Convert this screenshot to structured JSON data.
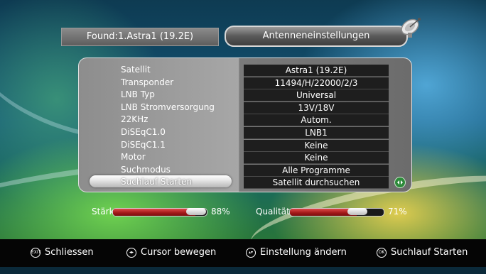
{
  "header": {
    "found_text": "Found:1.Astra1 (19.2E)",
    "title": "Antenneneinstellungen",
    "icon": "satellite-dish-icon"
  },
  "settings": [
    {
      "label": "Satellit",
      "value": "Astra1 (19.2E)"
    },
    {
      "label": "Transponder",
      "value": "11494/H/22000/2/3"
    },
    {
      "label": "LNB Typ",
      "value": "Universal"
    },
    {
      "label": "LNB Stromversorgung",
      "value": "13V/18V"
    },
    {
      "label": "22KHz",
      "value": "Autom."
    },
    {
      "label": "DiSEqC1.0",
      "value": "LNB1"
    },
    {
      "label": "DiSEqC1.1",
      "value": "Keine"
    },
    {
      "label": "Motor",
      "value": "Keine"
    },
    {
      "label": "Suchmodus",
      "value": "Alle Programme"
    },
    {
      "label": "Suchlauf Starten",
      "value": "Satellit durchsuchen",
      "selected": true
    }
  ],
  "signal": {
    "strength_label": "Stärke",
    "strength_value": 0.88,
    "strength_text": "88%",
    "quality_label": "Qualität",
    "quality_value": 0.71,
    "quality_text": "71%"
  },
  "help": [
    {
      "icon": "exit-button-icon",
      "icon_text": "EXIT",
      "label": "Schliessen"
    },
    {
      "icon": "arrow-keys-icon",
      "icon_text": "◂▸",
      "label": "Cursor bewegen"
    },
    {
      "icon": "up-down-keys-icon",
      "icon_text": "▴▾",
      "label": "Einstellung ändern"
    },
    {
      "icon": "ok-button-icon",
      "icon_text": "OK",
      "label": "Suchlauf Starten"
    }
  ],
  "colors": {
    "accent_red": "#b01c1c",
    "ok_green": "#2d8a3a",
    "value_bg": "#1e1e1e"
  }
}
